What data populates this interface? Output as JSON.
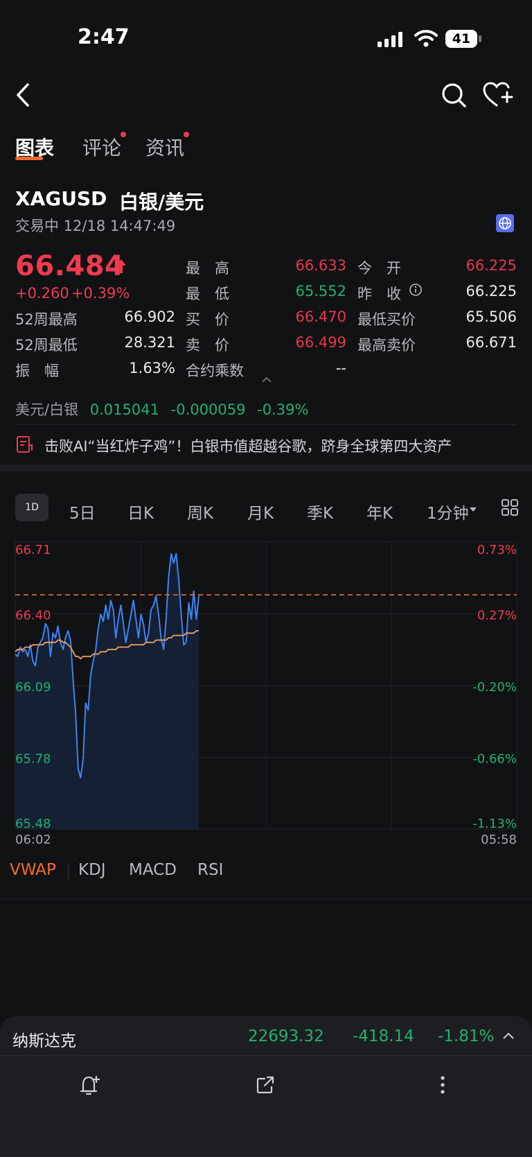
{
  "status_bar": {
    "time": "2:47",
    "battery": "41"
  },
  "tabs": [
    {
      "label": "图表",
      "active": true
    },
    {
      "label": "评论",
      "dot": true
    },
    {
      "label": "资讯",
      "dot": true
    }
  ],
  "quote": {
    "symbol": "XAGUSD",
    "name": "白银/美元",
    "status": "交易中 12/18 14:47:49",
    "price": "66.484",
    "change": "+0.260",
    "change_pct": "+0.39%",
    "stats_left": [
      {
        "label": "52周最高",
        "value": "66.902"
      },
      {
        "label": "52周最低",
        "value": "28.321"
      },
      {
        "label": "振　幅",
        "value": "1.63%"
      }
    ],
    "stats_mid": [
      {
        "label": "最　高",
        "value": "66.633",
        "color": "red"
      },
      {
        "label": "最　低",
        "value": "65.552",
        "color": "green"
      },
      {
        "label": "买　价",
        "value": "66.470",
        "color": "red"
      },
      {
        "label": "卖　价",
        "value": "66.499",
        "color": "red"
      },
      {
        "label": "合约乘数",
        "value": "--",
        "color": "white"
      }
    ],
    "stats_right": [
      {
        "label": "今　开",
        "value": "66.225",
        "color": "red"
      },
      {
        "label": "昨　收",
        "value": "66.225",
        "color": "white"
      },
      {
        "label": "最低买价",
        "value": "65.506",
        "color": "white"
      },
      {
        "label": "最高卖价",
        "value": "66.671",
        "color": "white"
      }
    ]
  },
  "fx_row": {
    "label": "美元/白银",
    "value": "0.015041",
    "change": "-0.000059",
    "change_pct": "-0.39%"
  },
  "news": {
    "text": "击败AI“当红炸子鸡”！白银市值超越谷歌，跻身全球第四大资产"
  },
  "periods": [
    "1D",
    "5日",
    "日K",
    "周K",
    "月K",
    "季K",
    "年K",
    "1分钟"
  ],
  "chart_data": {
    "type": "line",
    "y_ticks": [
      "66.71",
      "66.40",
      "66.09",
      "65.78",
      "65.48"
    ],
    "pct_ticks": [
      "0.73%",
      "0.27%",
      "-0.20%",
      "-0.66%",
      "-1.13%"
    ],
    "x_labels": [
      "06:02",
      "05:58"
    ],
    "ylim": [
      65.48,
      66.71
    ],
    "reference_line": 66.484,
    "series": [
      {
        "values": [
          66.23,
          66.22,
          66.26,
          66.24,
          66.25,
          66.22,
          66.27,
          66.2,
          66.18,
          66.26,
          66.28,
          66.3,
          66.36,
          66.34,
          66.22,
          66.32,
          66.3,
          66.35,
          66.28,
          66.25,
          66.3,
          66.33,
          66.29,
          66.12,
          65.98,
          65.74,
          65.7,
          65.78,
          66.02,
          65.99,
          66.14,
          66.2,
          66.25,
          66.34,
          66.4,
          66.37,
          66.44,
          66.38,
          66.46,
          66.42,
          66.3,
          66.38,
          66.44,
          66.36,
          66.28,
          66.34,
          66.4,
          66.46,
          66.38,
          66.3,
          66.4,
          66.36,
          66.28,
          66.32,
          66.42,
          66.44,
          66.48,
          66.4,
          66.3,
          66.25,
          66.38,
          66.56,
          66.66,
          66.62,
          66.66,
          66.55,
          66.4,
          66.27,
          66.28,
          66.45,
          66.38,
          66.5,
          66.38,
          66.48
        ]
      },
      {
        "values": [
          66.24,
          66.25,
          66.25,
          66.25,
          66.26,
          66.26,
          66.26,
          66.27,
          66.27,
          66.27,
          66.27,
          66.27,
          66.28,
          66.28,
          66.28,
          66.28,
          66.28,
          66.29,
          66.29,
          66.28,
          66.28,
          66.27,
          66.26,
          66.24,
          66.22,
          66.22,
          66.21,
          66.22,
          66.22,
          66.22,
          66.22,
          66.23,
          66.23,
          66.23,
          66.24,
          66.24,
          66.24,
          66.25,
          66.25,
          66.25,
          66.25,
          66.26,
          66.26,
          66.26,
          66.26,
          66.26,
          66.27,
          66.27,
          66.27,
          66.27,
          66.27,
          66.27,
          66.28,
          66.28,
          66.28,
          66.28,
          66.29,
          66.29,
          66.29,
          66.29,
          66.29,
          66.3,
          66.3,
          66.31,
          66.31,
          66.31,
          66.31,
          66.31,
          66.32,
          66.32,
          66.32,
          66.32,
          66.33,
          66.33
        ]
      }
    ]
  },
  "indicators": [
    "VWAP",
    "KDJ",
    "MACD",
    "RSI"
  ],
  "bottom_ticker": {
    "name": "纳斯达克",
    "value": "22693.32",
    "change": "-418.14",
    "change_pct": "-1.81%"
  },
  "colors": {
    "up": "#ef3a50",
    "down": "#1fb26c",
    "accent": "#f26d2a",
    "line": "#3d84f5",
    "avg": "#f0a15c"
  }
}
